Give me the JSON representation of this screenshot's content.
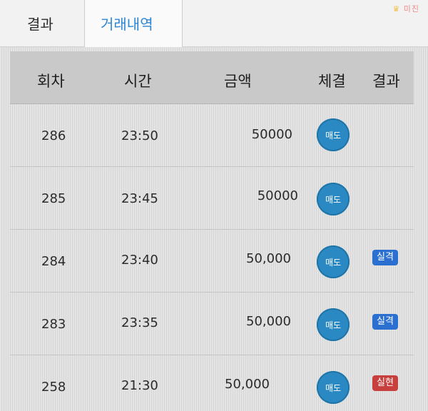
{
  "tabs": {
    "result_label": "결과",
    "history_label": "거래내역"
  },
  "watermark": "미진",
  "table": {
    "headers": {
      "round": "회차",
      "time": "시간",
      "amount": "금액",
      "execution": "체결",
      "result": "결과"
    },
    "rows": [
      {
        "round": "286",
        "time": "23:50",
        "amount": "50000",
        "execution": "매도",
        "result": "",
        "result_color": ""
      },
      {
        "round": "285",
        "time": "23:45",
        "amount": "50000",
        "execution": "매도",
        "result": "",
        "result_color": ""
      },
      {
        "round": "284",
        "time": "23:40",
        "amount": "50,000",
        "execution": "매도",
        "result": "실격",
        "result_color": "#2b6fd1"
      },
      {
        "round": "283",
        "time": "23:35",
        "amount": "50,000",
        "execution": "매도",
        "result": "실격",
        "result_color": "#2b6fd1"
      },
      {
        "round": "258",
        "time": "21:30",
        "amount": "50,000",
        "execution": "매도",
        "result": "실현",
        "result_color": "#c8403e"
      }
    ]
  },
  "colors": {
    "active_tab": "#2c86d6",
    "exec_button": "#2a89c3",
    "badge_blue": "#2b6fd1",
    "badge_red": "#c8403e"
  }
}
